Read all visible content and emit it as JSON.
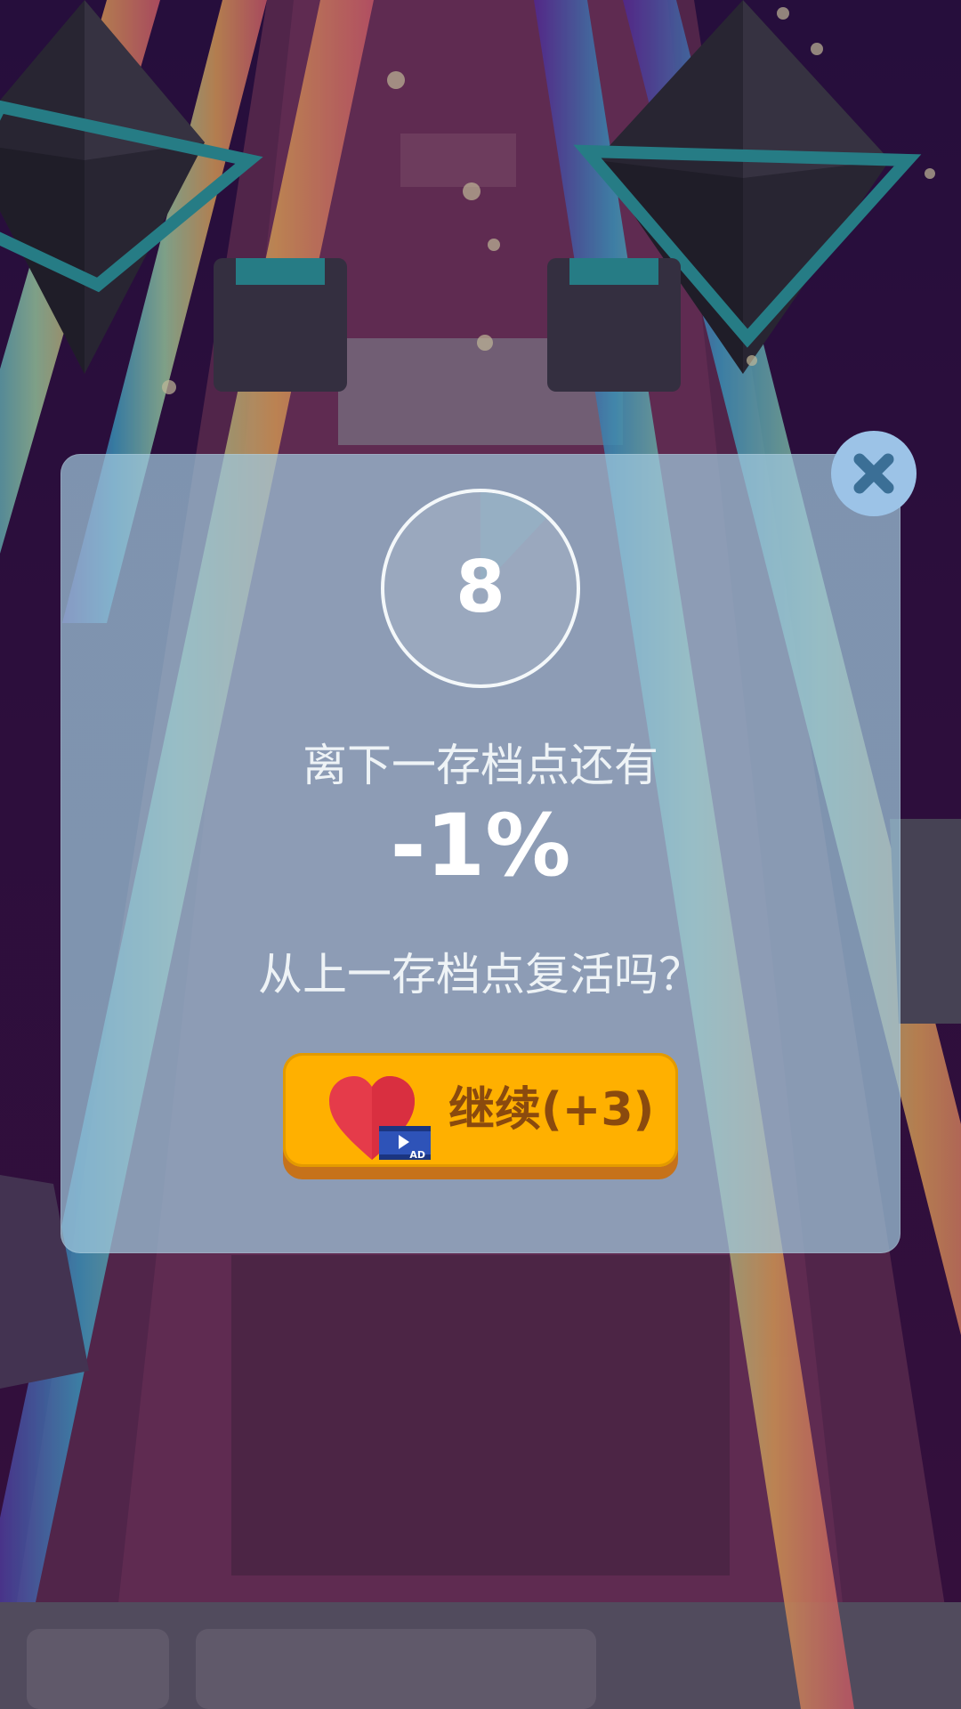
{
  "countdown": {
    "value": "8",
    "progress": 0.12
  },
  "checkpoint": {
    "distance_label": "离下一存档点还有",
    "percent": "-1%",
    "question": "从上一存档点复活吗？"
  },
  "continue_button": {
    "label": "继续(+3)",
    "ad_badge": "AD"
  },
  "colors": {
    "button_yellow": "#ffb000",
    "button_shadow": "#c6721a",
    "button_text": "#8a4a0e",
    "panel": "#a0c8dc",
    "close": "#9cc3e7",
    "heart": "#e53b4a"
  },
  "icons": [
    "close-icon",
    "heart-icon",
    "video-ad-icon"
  ]
}
